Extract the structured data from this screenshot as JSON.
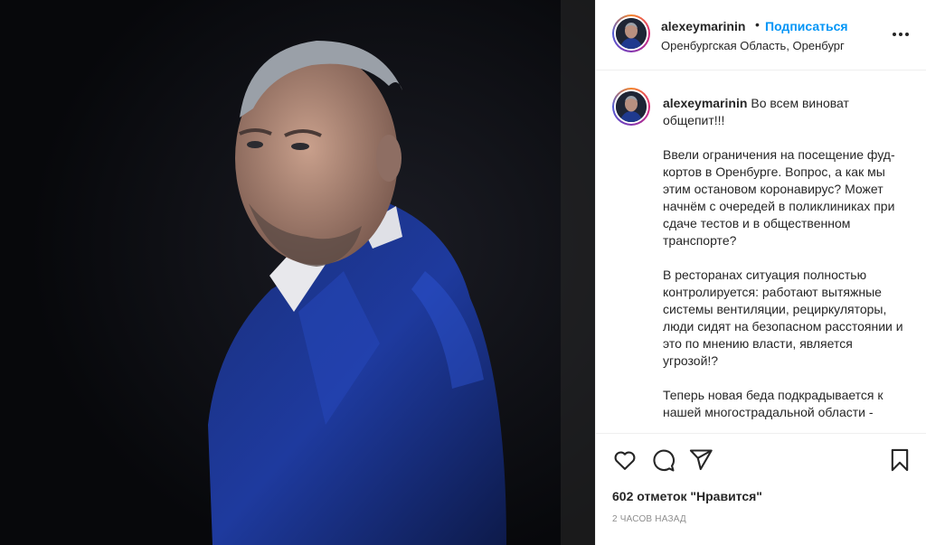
{
  "post": {
    "photo_alt": "Портрет мужчины в синем пиджаке на тёмном фоне"
  },
  "header": {
    "username": "alexeymarinin",
    "separator": "•",
    "follow_label": "Подписаться",
    "location": "Оренбургская Область, Оренбург",
    "more_icon": "more-horizontal-icon"
  },
  "caption": {
    "username": "alexeymarinin",
    "text": "Во всем виноват общепит!!!\n\nВвели ограничения на посещение фуд-кортов в Оренбурге. Вопрос, а как мы этим остановом коронавирус? Может начнём с очередей в поликлиниках при сдаче тестов и в общественном транспорте?\n\nВ ресторанах ситуация полностью контролируется: работают вытяжные системы вентиляции, рециркуляторы, люди сидят на безопасном расстоянии и это по мнению власти, является угрозой!?\n\nТеперь новая беда подкрадывается к нашей многострадальной области -"
  },
  "actions": {
    "like_icon": "heart-icon",
    "comment_icon": "comment-icon",
    "share_icon": "share-icon",
    "save_icon": "bookmark-icon",
    "likes_text": "602 отметок \"Нравится\"",
    "time_text": "2 часов назад"
  }
}
